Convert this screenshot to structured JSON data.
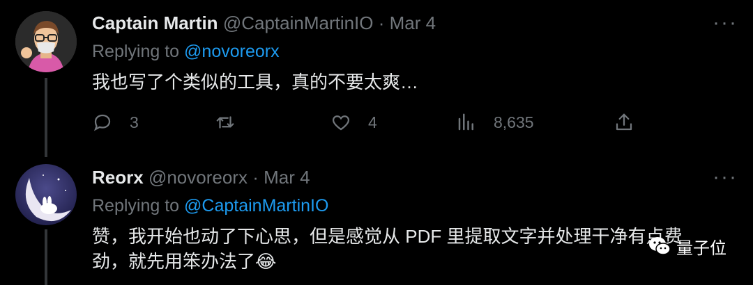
{
  "tweets": [
    {
      "name": "Captain Martin",
      "handle": "@CaptainMartinIO",
      "date": "· Mar 4",
      "replying_label": "Replying to",
      "replying_handle": "@novoreorx",
      "text": "我也写了个类似的工具，真的不要太爽…",
      "avatar_icon": "memoji-avatar-icon",
      "actions": {
        "reply_count": "3",
        "retweet_count": "",
        "like_count": "4",
        "views_count": "8,635"
      }
    },
    {
      "name": "Reorx",
      "handle": "@novoreorx",
      "date": "· Mar 4",
      "replying_label": "Replying to",
      "replying_handle": "@CaptainMartinIO",
      "text_line1": "赞，我开始也动了下心思，但是感觉从 PDF 里提取文字并处理干净有点费",
      "text_line2": "劲，就先用笨办法了😂",
      "avatar_icon": "moon-rabbit-avatar-icon"
    }
  ],
  "more_icon_label": "···",
  "watermark": {
    "text": "量子位"
  },
  "colors": {
    "background": "#000000",
    "text": "#e7e9ea",
    "muted": "#71767b",
    "link": "#1d9bf0",
    "thread": "#333639"
  }
}
